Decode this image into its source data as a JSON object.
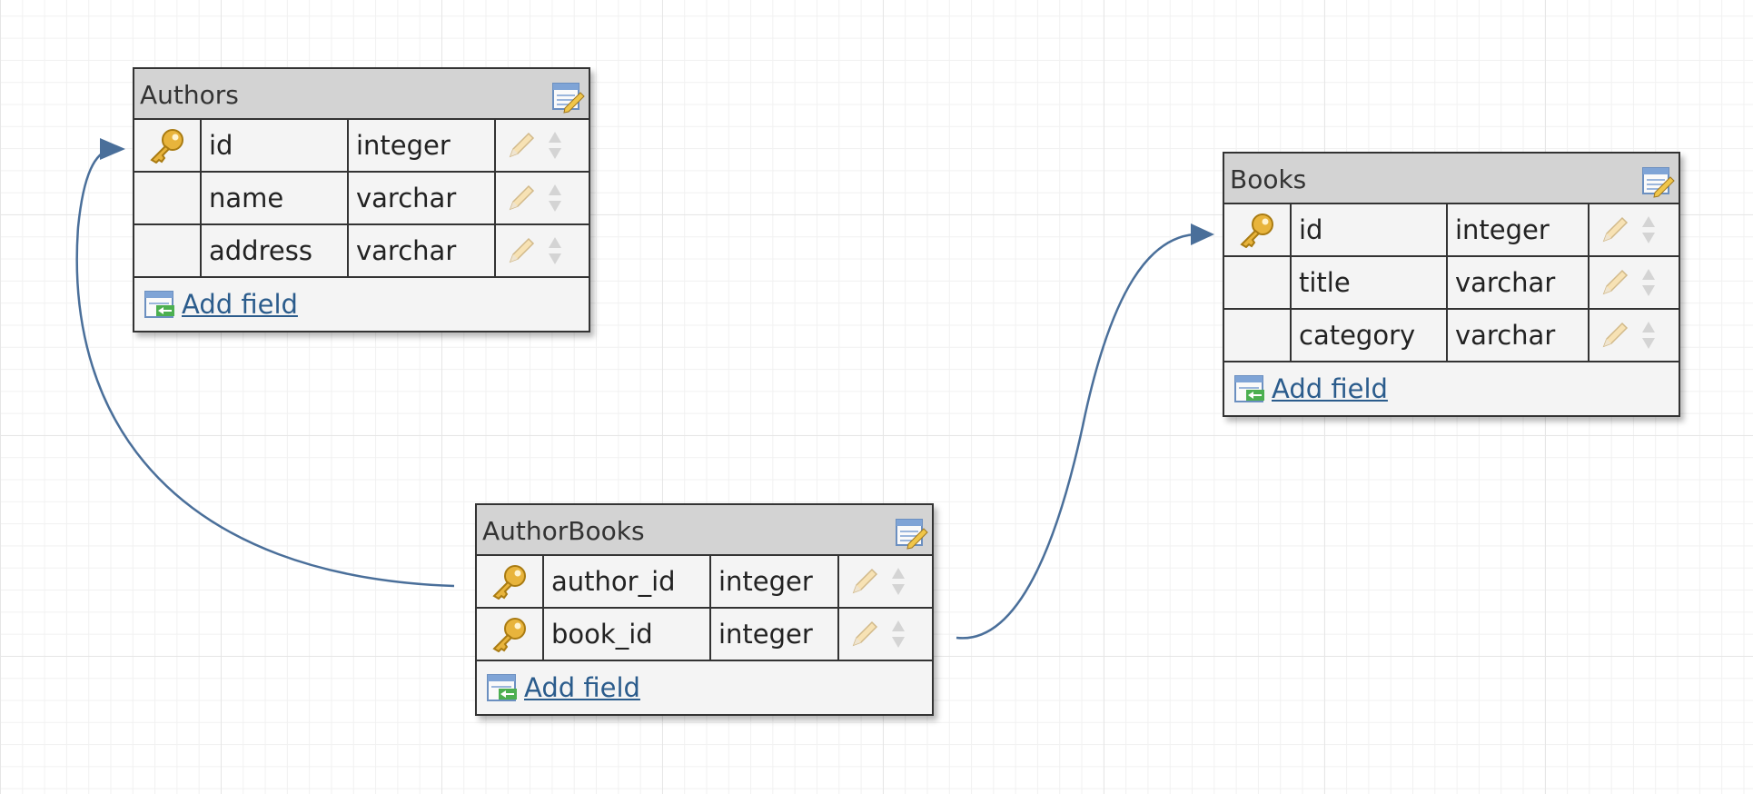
{
  "tables": {
    "authors": {
      "title": "Authors",
      "add_label": "Add field",
      "fields": [
        {
          "name": "id",
          "type": "integer",
          "key": true
        },
        {
          "name": "name",
          "type": "varchar",
          "key": false
        },
        {
          "name": "address",
          "type": "varchar",
          "key": false
        }
      ]
    },
    "books": {
      "title": "Books",
      "add_label": "Add field",
      "fields": [
        {
          "name": "id",
          "type": "integer",
          "key": true
        },
        {
          "name": "title",
          "type": "varchar",
          "key": false
        },
        {
          "name": "category",
          "type": "varchar",
          "key": false
        }
      ]
    },
    "authorbooks": {
      "title": "AuthorBooks",
      "add_label": "Add field",
      "fields": [
        {
          "name": "author_id",
          "type": "integer",
          "key": true
        },
        {
          "name": "book_id",
          "type": "integer",
          "key": true
        }
      ]
    }
  },
  "relations": [
    {
      "from": "AuthorBooks.author_id",
      "to": "Authors.id"
    },
    {
      "from": "AuthorBooks.book_id",
      "to": "Books.id"
    }
  ],
  "colors": {
    "connector": "#4a6f9a",
    "header": "#d3d3d3",
    "link": "#2b5c8c",
    "key_icon": "#e8b43c"
  },
  "icons": {
    "primary_key": "key-icon",
    "edit_table": "edit-table-icon",
    "edit_field": "pencil-icon",
    "reorder": "sort-arrows-icon",
    "add_field": "add-field-icon"
  }
}
